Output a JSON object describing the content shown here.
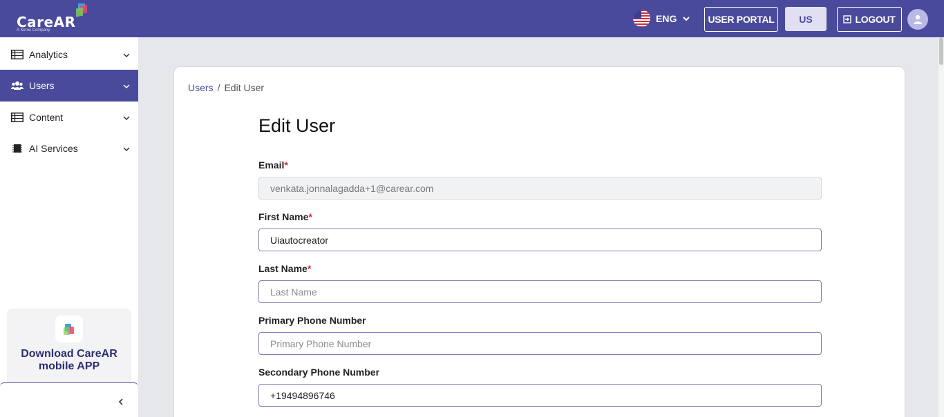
{
  "header": {
    "logo_text": "CareAR",
    "logo_sub": "A Xerox Company",
    "language": "ENG",
    "user_portal_label": "USER PORTAL",
    "region_label": "US",
    "logout_label": "LOGOUT",
    "icons": [
      "us-flag-icon",
      "chevron-down-icon",
      "logout-icon",
      "user-avatar-icon"
    ],
    "brand_color": "#4a4a9c"
  },
  "sidebar": {
    "items": [
      {
        "label": "Analytics",
        "icon": "table-icon",
        "active": false
      },
      {
        "label": "Users",
        "icon": "users-icon",
        "active": true
      },
      {
        "label": "Content",
        "icon": "table-icon",
        "active": false
      },
      {
        "label": "AI Services",
        "icon": "chip-icon",
        "active": false
      }
    ],
    "promo_text": "Download CareAR mobile APP",
    "collapse_icon": "chevron-left-icon"
  },
  "main": {
    "breadcrumb": {
      "parent": "Users",
      "separator": "/",
      "current": "Edit User"
    },
    "title": "Edit User",
    "form": {
      "email": {
        "label": "Email",
        "required": "*",
        "value": "venkata.jonnalagadda+1@carear.com",
        "disabled": true
      },
      "first_name": {
        "label": "First Name",
        "required": "*",
        "value": "Uiautocreator"
      },
      "last_name": {
        "label": "Last Name",
        "required": "*",
        "value": "",
        "placeholder": "Last Name"
      },
      "primary_phone": {
        "label": "Primary Phone Number",
        "value": "",
        "placeholder": "Primary Phone Number"
      },
      "secondary_phone": {
        "label": "Secondary Phone Number",
        "value": "+19494896746"
      }
    }
  }
}
